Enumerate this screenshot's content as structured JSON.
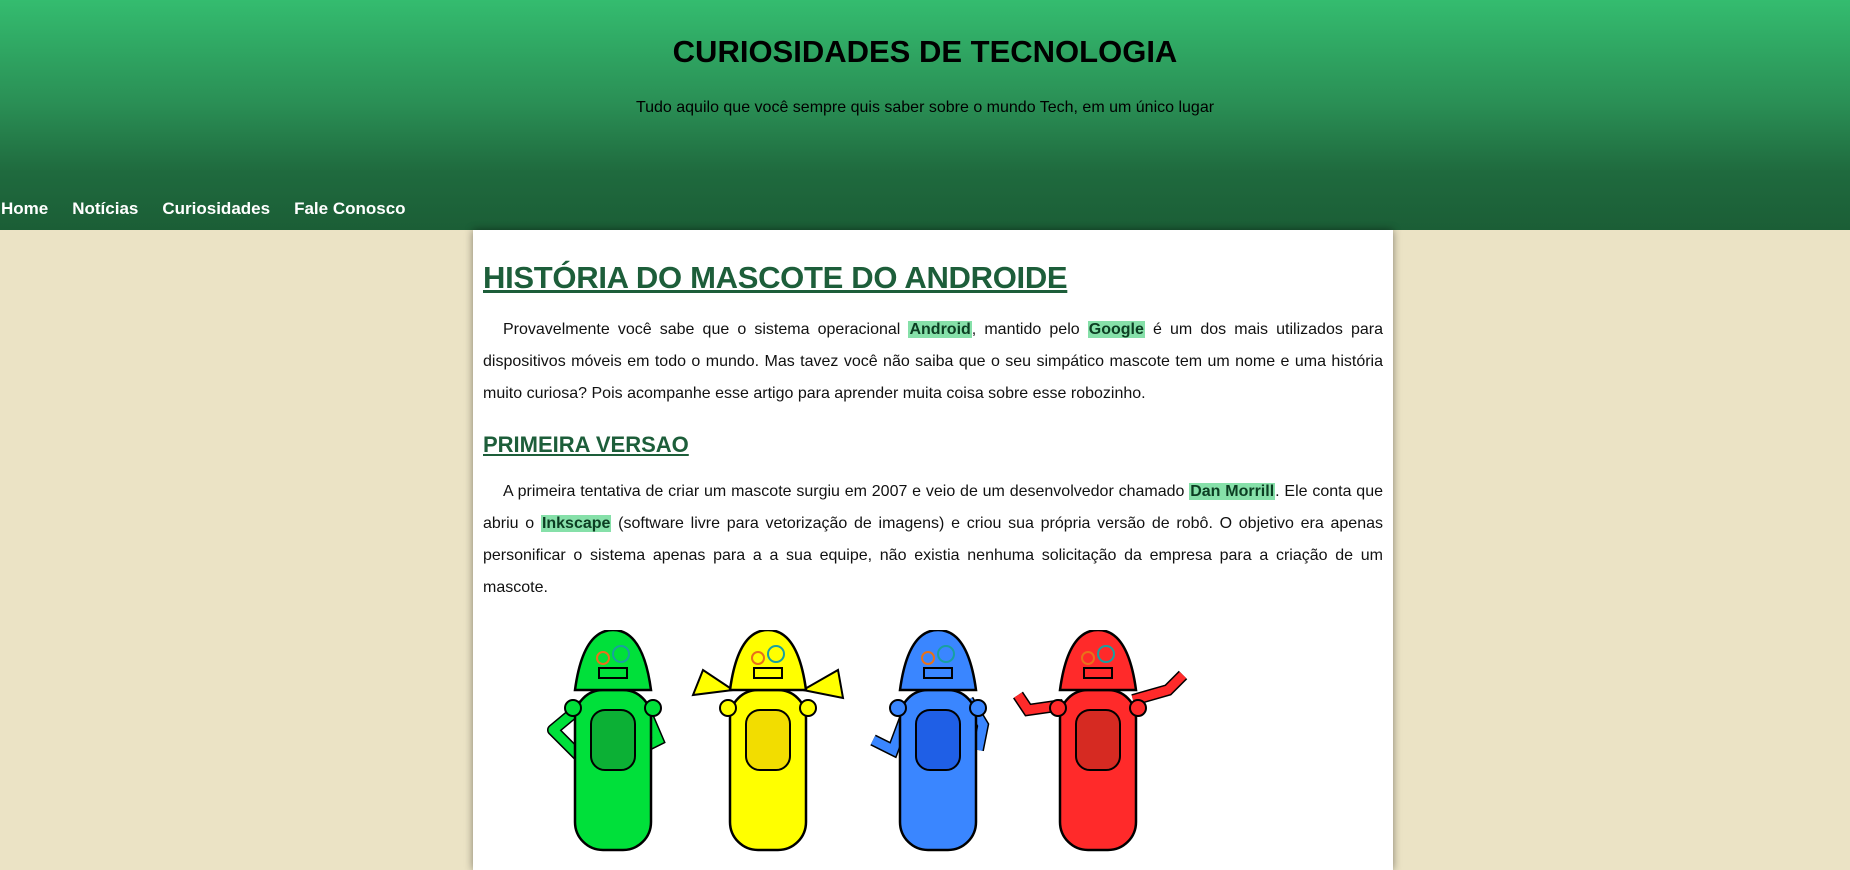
{
  "header": {
    "title": "CURIOSIDADES DE TECNOLOGIA",
    "subtitle": "Tudo aquilo que você sempre quis saber sobre o mundo Tech, em um único lugar"
  },
  "nav": {
    "items": [
      {
        "label": "Home"
      },
      {
        "label": "Notícias"
      },
      {
        "label": "Curiosidades"
      },
      {
        "label": "Fale Conosco"
      }
    ]
  },
  "article": {
    "title": "HISTÓRIA DO MASCOTE DO ANDROIDE",
    "intro": {
      "t1": "Provavelmente você sabe que o sistema operacional ",
      "h1": "Android",
      "t2": ", mantido pelo ",
      "h2": "Google",
      "t3": " é um dos mais utilizados para dispositivos móveis em todo o mundo. Mas tavez você não saiba que o seu simpático mascote tem um nome e uma história muito curiosa? Pois acompanhe esse artigo para aprender muita coisa sobre esse robozinho."
    },
    "section1": {
      "title": "PRIMEIRA VERSAO",
      "t1": "A primeira tentativa de criar um mascote surgiu em 2007 e veio de um desenvolvedor chamado ",
      "h1": "Dan Morrill",
      "t2": ". Ele conta que abriu o ",
      "h2": "Inkscape",
      "t3": " (software livre para vetorização de imagens) e criou sua própria versão de robô. O objetivo era apenas personificar o sistema apenas para a a sua equipe, não existia nenhuma solicitação da empresa para a criação de um mascote."
    },
    "mascots": {
      "colors": [
        "#00e03a",
        "#ffff00",
        "#3a86ff",
        "#ff2a2a"
      ],
      "inner_colors": [
        "#0cb035",
        "#f2dd00",
        "#1f5fe6",
        "#d62a22"
      ]
    }
  }
}
